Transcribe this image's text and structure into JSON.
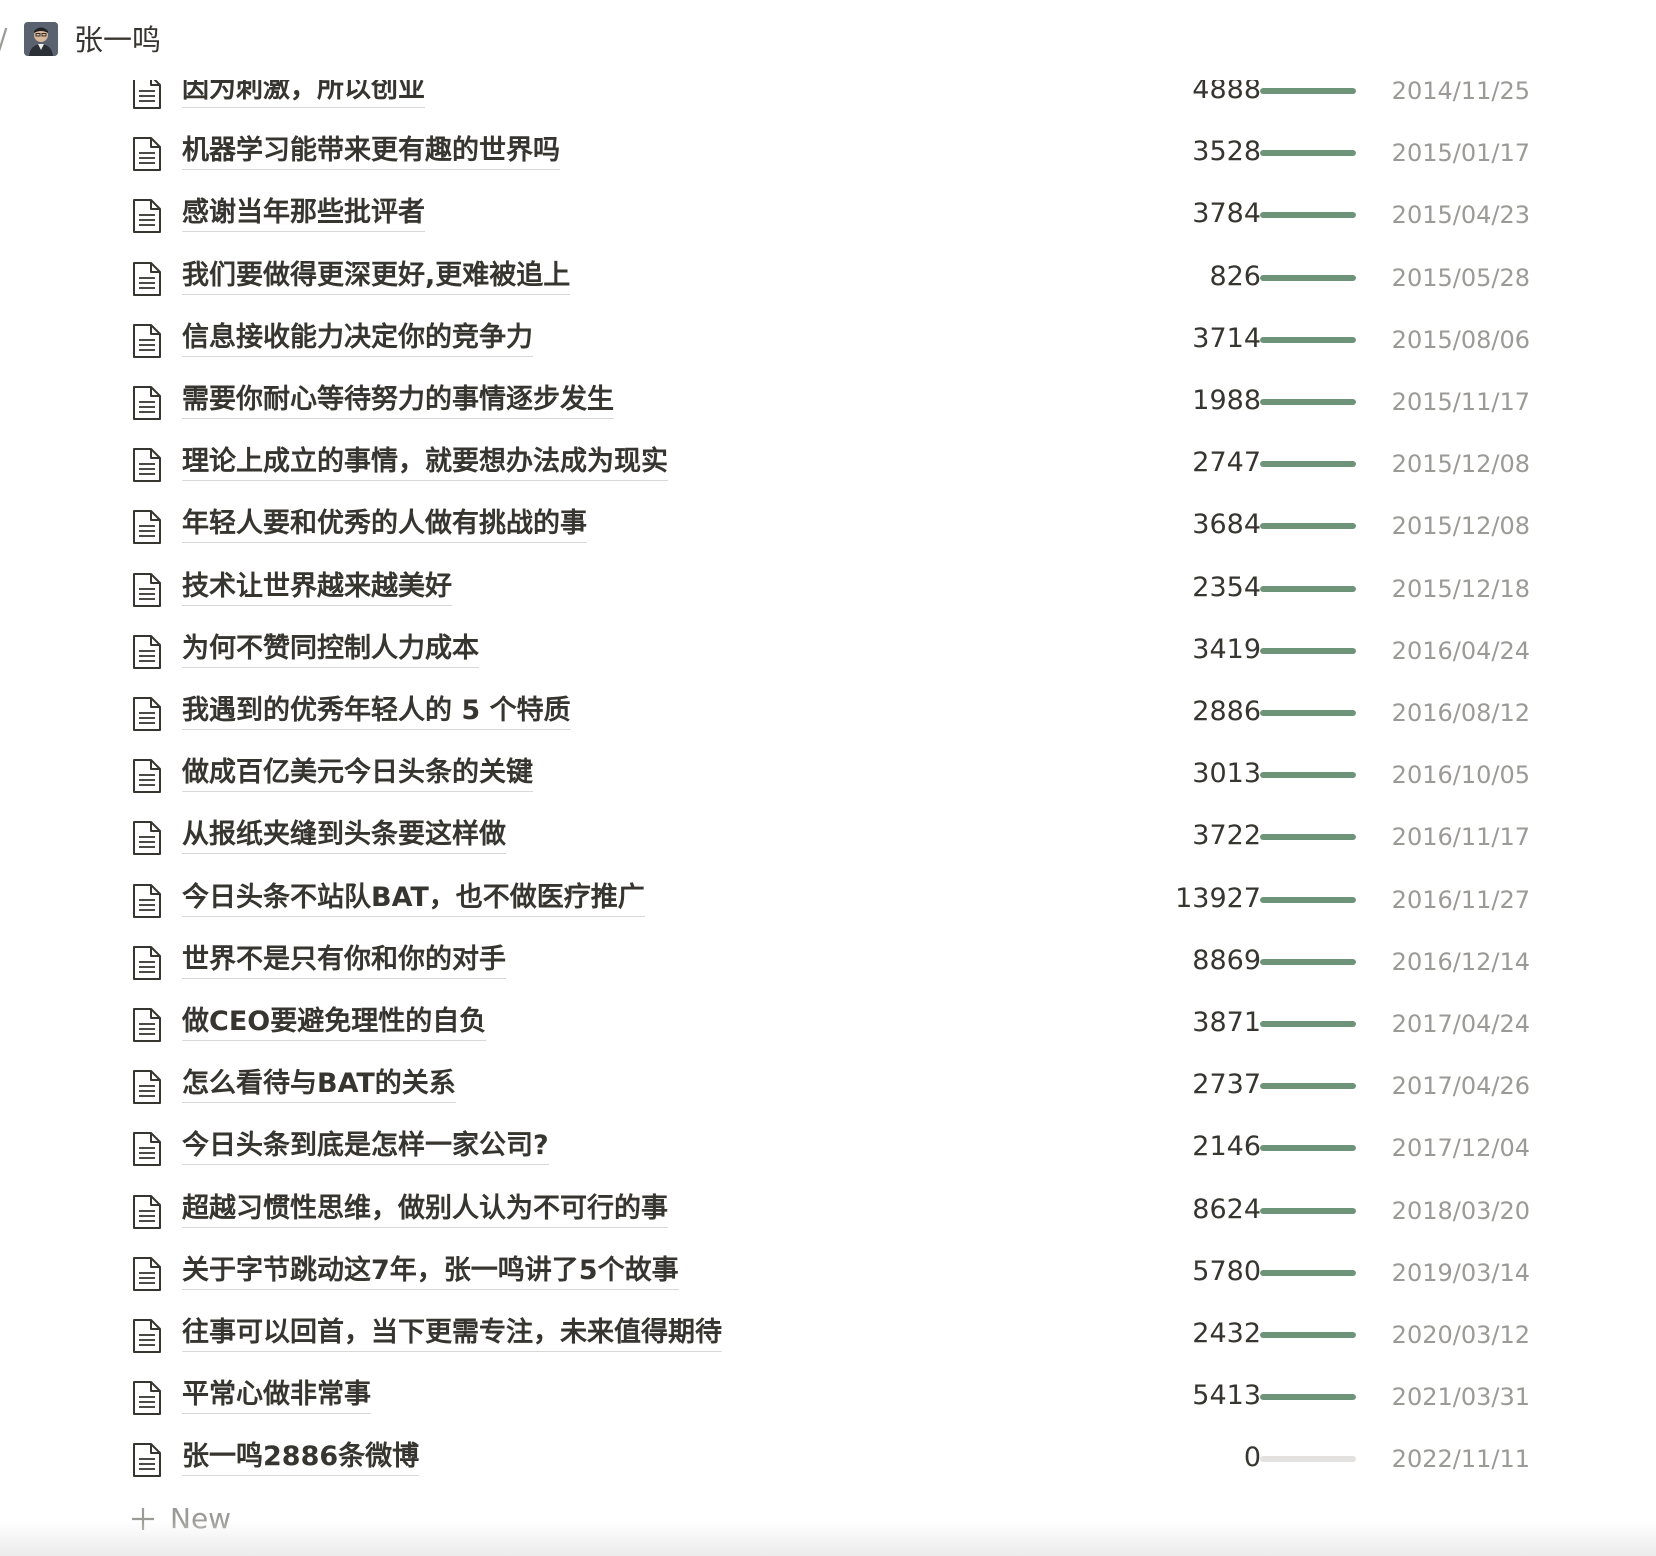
{
  "breadcrumb": {
    "separator": "/",
    "title": "张一鸣"
  },
  "rows": [
    {
      "title": "因为刺激，所以创业",
      "count": "4888",
      "progress": 1.0,
      "date": "2014/11/25"
    },
    {
      "title": "机器学习能带来更有趣的世界吗",
      "count": "3528",
      "progress": 1.0,
      "date": "2015/01/17"
    },
    {
      "title": "感谢当年那些批评者",
      "count": "3784",
      "progress": 1.0,
      "date": "2015/04/23"
    },
    {
      "title": "我们要做得更深更好,更难被追上",
      "count": "826",
      "progress": 1.0,
      "date": "2015/05/28"
    },
    {
      "title": "信息接收能力决定你的竞争力",
      "count": "3714",
      "progress": 1.0,
      "date": "2015/08/06"
    },
    {
      "title": "需要你耐心等待努力的事情逐步发生",
      "count": "1988",
      "progress": 1.0,
      "date": "2015/11/17"
    },
    {
      "title": "理论上成立的事情，就要想办法成为现实",
      "count": "2747",
      "progress": 1.0,
      "date": "2015/12/08"
    },
    {
      "title": "年轻人要和优秀的人做有挑战的事",
      "count": "3684",
      "progress": 1.0,
      "date": "2015/12/08"
    },
    {
      "title": "技术让世界越来越美好",
      "count": "2354",
      "progress": 1.0,
      "date": "2015/12/18"
    },
    {
      "title": "为何不赞同控制人力成本",
      "count": "3419",
      "progress": 1.0,
      "date": "2016/04/24"
    },
    {
      "title": "我遇到的优秀年轻人的 5 个特质",
      "count": "2886",
      "progress": 1.0,
      "date": "2016/08/12"
    },
    {
      "title": "做成百亿美元今日头条的关键",
      "count": "3013",
      "progress": 1.0,
      "date": "2016/10/05"
    },
    {
      "title": "从报纸夹缝到头条要这样做",
      "count": "3722",
      "progress": 1.0,
      "date": "2016/11/17"
    },
    {
      "title": "今日头条不站队BAT，也不做医疗推广",
      "count": "13927",
      "progress": 1.0,
      "date": "2016/11/27"
    },
    {
      "title": "世界不是只有你和你的对手",
      "count": "8869",
      "progress": 1.0,
      "date": "2016/12/14"
    },
    {
      "title": "做CEO要避免理性的自负",
      "count": "3871",
      "progress": 1.0,
      "date": "2017/04/24"
    },
    {
      "title": "怎么看待与BAT的关系",
      "count": "2737",
      "progress": 1.0,
      "date": "2017/04/26"
    },
    {
      "title": "今日头条到底是怎样一家公司?",
      "count": "2146",
      "progress": 1.0,
      "date": "2017/12/04"
    },
    {
      "title": "超越习惯性思维，做别人认为不可行的事",
      "count": "8624",
      "progress": 1.0,
      "date": "2018/03/20"
    },
    {
      "title": "关于字节跳动这7年，张一鸣讲了5个故事",
      "count": "5780",
      "progress": 1.0,
      "date": "2019/03/14"
    },
    {
      "title": "往事可以回首，当下更需专注，未来值得期待",
      "count": "2432",
      "progress": 1.0,
      "date": "2020/03/12"
    },
    {
      "title": "平常心做非常事",
      "count": "5413",
      "progress": 1.0,
      "date": "2021/03/31"
    },
    {
      "title": "张一鸣2886条微博",
      "count": "0",
      "progress": 0.0,
      "date": "2022/11/11"
    }
  ],
  "new_button": {
    "label": "New"
  },
  "colors": {
    "progress_fill": "#6d9478",
    "progress_track": "#e3e2e0",
    "text": "#37352f",
    "muted": "#9b9a97"
  },
  "icons": {
    "row_icon": "page-icon",
    "new_icon": "plus-icon",
    "avatar": "user-avatar"
  }
}
